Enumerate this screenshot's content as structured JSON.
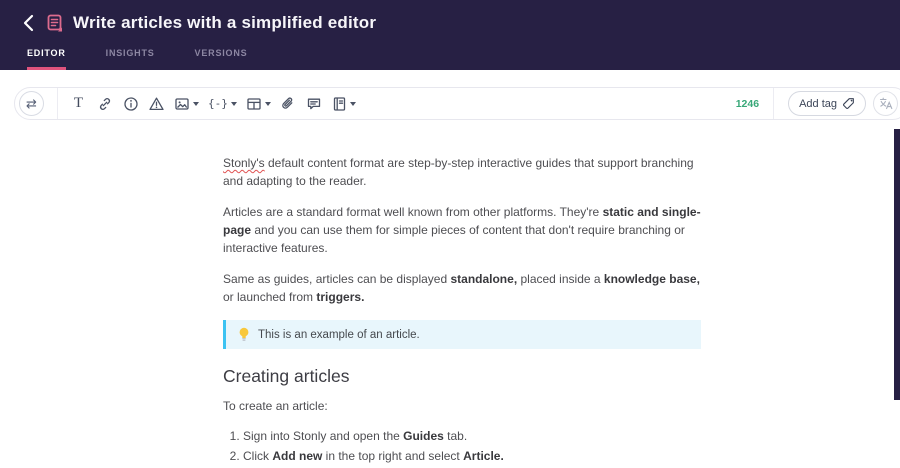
{
  "colors": {
    "header_bg": "#272044",
    "accent_pink": "#e0537d",
    "count_green": "#38a878",
    "callout_border": "#3cc3f2",
    "callout_bg": "#e8f6fc"
  },
  "header": {
    "title": "Write articles with a simplified editor",
    "tabs": [
      {
        "label": "EDITOR",
        "active": true
      },
      {
        "label": "INSIGHTS",
        "active": false
      },
      {
        "label": "VERSIONS",
        "active": false
      }
    ]
  },
  "toolbar": {
    "swap_glyph": "⇄",
    "text_glyph": "T",
    "braces_glyph": "{-}",
    "char_count": "1246",
    "add_tag_label": "Add tag",
    "icons": [
      "swap",
      "text",
      "link",
      "info",
      "warning",
      "image",
      "variable",
      "table",
      "attachment",
      "note",
      "knowledge-base",
      "tag",
      "translate"
    ]
  },
  "article": {
    "p1": {
      "misspelled": "Stonly's",
      "rest": " default content format are step-by-step interactive guides that support branching and adapting to the reader."
    },
    "p2": {
      "r0": "Articles are a standard format well known from other platforms. They're ",
      "b1": "static and single-page",
      "r2": " and you can use them for simple pieces of content that don't require branching or interactive features."
    },
    "p3": {
      "r0": "Same as guides, articles can be displayed ",
      "b1": "standalone,",
      "r2": " placed inside a ",
      "b3": "knowledge base,",
      "r4": " or launched from ",
      "b5": "triggers."
    },
    "callout": {
      "icon": "lightbulb",
      "text": "This is an example of an article."
    },
    "heading": "Creating articles",
    "p4": "To create an article:",
    "list": [
      {
        "r0": "Sign into Stonly and open the ",
        "b1": "Guides",
        "r2": " tab."
      },
      {
        "r0": "Click ",
        "b1": "Add new",
        "r2": " in the top right and select ",
        "b3": "Article."
      }
    ]
  }
}
